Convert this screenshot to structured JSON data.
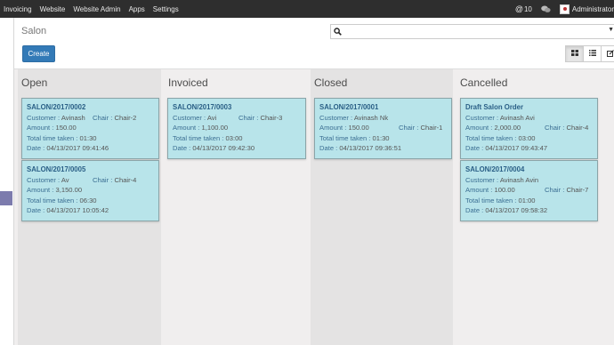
{
  "topbar": {
    "menu": [
      "Invoicing",
      "Website",
      "Website Admin",
      "Apps",
      "Settings"
    ],
    "notifications_count": "10",
    "notification_icon": "at-icon",
    "chat_icon": "chat-bubbles-icon",
    "user_name": "Administrator"
  },
  "breadcrumb": "Salon",
  "create_label": "Create",
  "search": {
    "placeholder": "",
    "value": ""
  },
  "view_switch": [
    "kanban-view-icon",
    "list-view-icon",
    "form-view-icon"
  ],
  "columns": [
    {
      "title": "Open",
      "cards": [
        {
          "ref": "SALON/2017/0002",
          "customer_label": "Customer :",
          "customer": "Avinash",
          "chair_label": "Chair :",
          "chair": "Chair-2",
          "amount_label": "Amount :",
          "amount": "150.00",
          "time_label": "Total time taken :",
          "time": "01:30",
          "date_label": "Date :",
          "date": "04/13/2017 09:41:46"
        },
        {
          "ref": "SALON/2017/0005",
          "customer_label": "Customer :",
          "customer": "Av",
          "chair_label": "Chair :",
          "chair": "Chair-4",
          "amount_label": "Amount :",
          "amount": "3,150.00",
          "time_label": "Total time taken :",
          "time": "06:30",
          "date_label": "Date :",
          "date": "04/13/2017 10:05:42"
        }
      ]
    },
    {
      "title": "Invoiced",
      "cards": [
        {
          "ref": "SALON/2017/0003",
          "customer_label": "Customer :",
          "customer": "Avi",
          "chair_label": "Chair :",
          "chair": "Chair-3",
          "amount_label": "Amount :",
          "amount": "1,100.00",
          "time_label": "Total time taken :",
          "time": "03:00",
          "date_label": "Date :",
          "date": "04/13/2017 09:42:30"
        }
      ]
    },
    {
      "title": "Closed",
      "cards": [
        {
          "ref": "SALON/2017/0001",
          "customer_label": "Customer :",
          "customer": "Avinash Nk",
          "chair_label": "Chair :",
          "chair": "Chair-1",
          "amount_label": "Amount :",
          "amount": "150.00",
          "time_label": "Total time taken :",
          "time": "01:30",
          "date_label": "Date :",
          "date": "04/13/2017 09:36:51"
        }
      ]
    },
    {
      "title": "Cancelled",
      "cards": [
        {
          "ref": "Draft Salon Order",
          "customer_label": "Customer :",
          "customer": "Avinash Avi",
          "chair_label": "Chair :",
          "chair": "Chair-4",
          "amount_label": "Amount :",
          "amount": "2,000.00",
          "time_label": "Total time taken :",
          "time": "03:00",
          "date_label": "Date :",
          "date": "04/13/2017 09:43:47"
        },
        {
          "ref": "SALON/2017/0004",
          "customer_label": "Customer :",
          "customer": "Avinash Avin",
          "chair_label": "Chair :",
          "chair": "Chair-7",
          "amount_label": "Amount :",
          "amount": "100.00",
          "time_label": "Total time taken :",
          "time": "01:00",
          "date_label": "Date :",
          "date": "04/13/2017 09:58:32"
        }
      ]
    }
  ],
  "colors": {
    "card_bg": "#b8e4ea",
    "primary": "#337ab7",
    "topbar": "#2e2e2e"
  }
}
